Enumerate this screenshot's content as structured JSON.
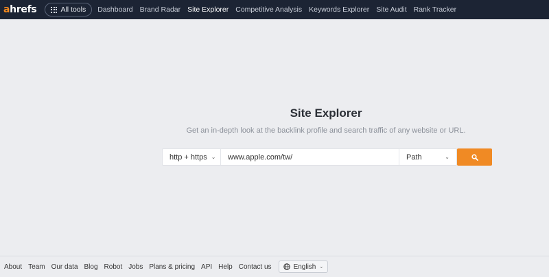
{
  "brand": {
    "logo_a": "a",
    "logo_rest": "hrefs"
  },
  "nav": {
    "all_tools": "All tools",
    "links": [
      "Dashboard",
      "Brand Radar",
      "Site Explorer",
      "Competitive Analysis",
      "Keywords Explorer",
      "Site Audit",
      "Rank Tracker"
    ],
    "active": "Site Explorer"
  },
  "main": {
    "title": "Site Explorer",
    "subtitle": "Get an in-depth look at the backlink profile and search traffic of any website or URL.",
    "protocol": "http + https",
    "url_value": "www.apple.com/tw/",
    "mode": "Path"
  },
  "footer": {
    "links": [
      "About",
      "Team",
      "Our data",
      "Blog",
      "Robot",
      "Jobs",
      "Plans & pricing",
      "API",
      "Help",
      "Contact us"
    ],
    "language": "English"
  },
  "colors": {
    "nav_bg": "#1c2434",
    "accent": "#f08a24",
    "page_bg": "#ecedf0"
  },
  "icons": {
    "all_tools": "grid-icon",
    "search": "search-icon",
    "language": "globe-icon"
  }
}
